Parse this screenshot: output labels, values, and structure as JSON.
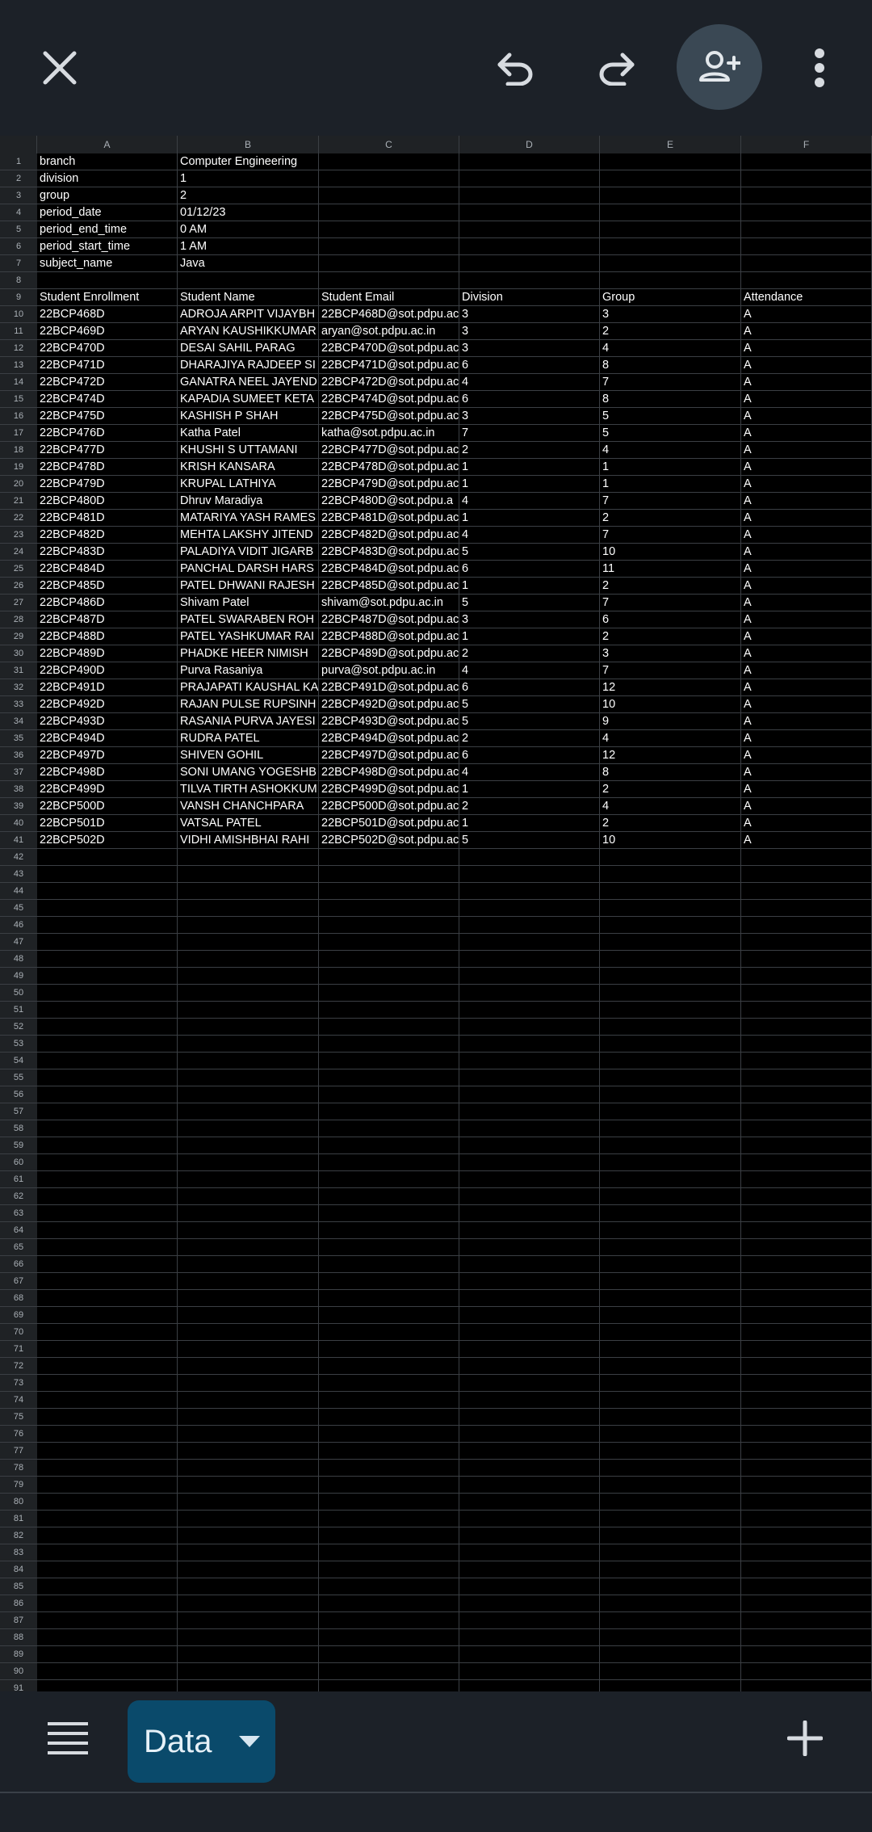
{
  "toolbar": {
    "close_icon": "close-icon",
    "undo_icon": "undo-icon",
    "redo_icon": "redo-icon",
    "share_icon": "add-person-icon",
    "more_icon": "more-vert-icon"
  },
  "columns": [
    "A",
    "B",
    "C",
    "D",
    "E",
    "F"
  ],
  "rows": [
    {
      "n": "1",
      "cells": [
        "branch",
        "Computer Engineering",
        "",
        "",
        "",
        ""
      ]
    },
    {
      "n": "2",
      "cells": [
        "division",
        "1",
        "",
        "",
        "",
        ""
      ]
    },
    {
      "n": "3",
      "cells": [
        "group",
        "2",
        "",
        "",
        "",
        ""
      ]
    },
    {
      "n": "4",
      "cells": [
        "period_date",
        "01/12/23",
        "",
        "",
        "",
        ""
      ]
    },
    {
      "n": "5",
      "cells": [
        "period_end_time",
        "0 AM",
        "",
        "",
        "",
        ""
      ]
    },
    {
      "n": "6",
      "cells": [
        "period_start_time",
        "1 AM",
        "",
        "",
        "",
        ""
      ]
    },
    {
      "n": "7",
      "cells": [
        "subject_name",
        "Java",
        "",
        "",
        "",
        ""
      ]
    },
    {
      "n": "8",
      "cells": [
        "",
        "",
        "",
        "",
        "",
        ""
      ]
    },
    {
      "n": "9",
      "cells": [
        "Student Enrollment",
        "Student Name",
        "Student Email",
        "Division",
        "Group",
        "Attendance"
      ]
    },
    {
      "n": "10",
      "cells": [
        "22BCP468D",
        "ADROJA ARPIT VIJAYBH",
        "22BCP468D@sot.pdpu.ac",
        "3",
        "3",
        "A"
      ]
    },
    {
      "n": "11",
      "cells": [
        "22BCP469D",
        "ARYAN KAUSHIKKUMAR",
        "aryan@sot.pdpu.ac.in",
        "3",
        "2",
        "A"
      ]
    },
    {
      "n": "12",
      "cells": [
        "22BCP470D",
        "DESAI SAHIL PARAG",
        "22BCP470D@sot.pdpu.ac",
        "3",
        "4",
        "A"
      ]
    },
    {
      "n": "13",
      "cells": [
        "22BCP471D",
        "DHARAJIYA RAJDEEP SI",
        "22BCP471D@sot.pdpu.ac",
        "6",
        "8",
        "A"
      ]
    },
    {
      "n": "14",
      "cells": [
        "22BCP472D",
        "GANATRA NEEL JAYEND",
        "22BCP472D@sot.pdpu.ac",
        "4",
        "7",
        "A"
      ]
    },
    {
      "n": "15",
      "cells": [
        "22BCP474D",
        "KAPADIA SUMEET KETA",
        "22BCP474D@sot.pdpu.ac",
        "6",
        "8",
        "A"
      ]
    },
    {
      "n": "16",
      "cells": [
        "22BCP475D",
        "KASHISH P SHAH",
        "22BCP475D@sot.pdpu.ac",
        "3",
        "5",
        "A"
      ]
    },
    {
      "n": "17",
      "cells": [
        "22BCP476D",
        "Katha Patel",
        "katha@sot.pdpu.ac.in",
        "7",
        "5",
        "A"
      ]
    },
    {
      "n": "18",
      "cells": [
        "22BCP477D",
        "KHUSHI S UTTAMANI",
        "22BCP477D@sot.pdpu.ac",
        "2",
        "4",
        "A"
      ]
    },
    {
      "n": "19",
      "cells": [
        "22BCP478D",
        "KRISH KANSARA",
        "22BCP478D@sot.pdpu.ac",
        "1",
        "1",
        "A"
      ]
    },
    {
      "n": "20",
      "cells": [
        "22BCP479D",
        "KRUPAL LATHIYA",
        "22BCP479D@sot.pdpu.ac",
        "1",
        "1",
        "A"
      ]
    },
    {
      "n": "21",
      "cells": [
        "22BCP480D",
        "Dhruv Maradiya",
        " 22BCP480D@sot.pdpu.a",
        "4",
        "7",
        "A"
      ]
    },
    {
      "n": "22",
      "cells": [
        "22BCP481D",
        "MATARIYA YASH RAMES",
        "22BCP481D@sot.pdpu.ac",
        "1",
        "2",
        "A"
      ]
    },
    {
      "n": "23",
      "cells": [
        "22BCP482D",
        "MEHTA LAKSHY JITEND",
        "22BCP482D@sot.pdpu.ac",
        "4",
        "7",
        "A"
      ]
    },
    {
      "n": "24",
      "cells": [
        "22BCP483D",
        "PALADIYA VIDIT JIGARB",
        "22BCP483D@sot.pdpu.ac",
        "5",
        "10",
        "A"
      ]
    },
    {
      "n": "25",
      "cells": [
        "22BCP484D",
        "PANCHAL DARSH HARS",
        "22BCP484D@sot.pdpu.ac",
        "6",
        "11",
        "A"
      ]
    },
    {
      "n": "26",
      "cells": [
        "22BCP485D",
        "PATEL DHWANI RAJESH",
        "22BCP485D@sot.pdpu.ac",
        "1",
        "2",
        "A"
      ]
    },
    {
      "n": "27",
      "cells": [
        "22BCP486D",
        "Shivam Patel",
        "shivam@sot.pdpu.ac.in",
        "5",
        "7",
        "A"
      ]
    },
    {
      "n": "28",
      "cells": [
        "22BCP487D",
        "PATEL SWARABEN ROH",
        "22BCP487D@sot.pdpu.ac",
        "3",
        "6",
        "A"
      ]
    },
    {
      "n": "29",
      "cells": [
        "22BCP488D",
        "PATEL YASHKUMAR RAI",
        "22BCP488D@sot.pdpu.ac",
        "1",
        "2",
        "A"
      ]
    },
    {
      "n": "30",
      "cells": [
        "22BCP489D",
        "PHADKE HEER NIMISH",
        "22BCP489D@sot.pdpu.ac",
        "2",
        "3",
        "A"
      ]
    },
    {
      "n": "31",
      "cells": [
        "22BCP490D",
        "Purva Rasaniya",
        "purva@sot.pdpu.ac.in",
        "4",
        "7",
        "A"
      ]
    },
    {
      "n": "32",
      "cells": [
        "22BCP491D",
        "PRAJAPATI KAUSHAL KA",
        "22BCP491D@sot.pdpu.ac",
        "6",
        "12",
        "A"
      ]
    },
    {
      "n": "33",
      "cells": [
        "22BCP492D",
        "RAJAN PULSE RUPSINH",
        "22BCP492D@sot.pdpu.ac",
        "5",
        "10",
        "A"
      ]
    },
    {
      "n": "34",
      "cells": [
        "22BCP493D",
        "RASANIA PURVA JAYESI",
        "22BCP493D@sot.pdpu.ac",
        "5",
        "9",
        "A"
      ]
    },
    {
      "n": "35",
      "cells": [
        "22BCP494D",
        "RUDRA PATEL",
        "22BCP494D@sot.pdpu.ac",
        "2",
        "4",
        "A"
      ]
    },
    {
      "n": "36",
      "cells": [
        "22BCP497D",
        "SHIVEN GOHIL",
        "22BCP497D@sot.pdpu.ac",
        "6",
        "12",
        "A"
      ]
    },
    {
      "n": "37",
      "cells": [
        "22BCP498D",
        "SONI UMANG YOGESHB",
        "22BCP498D@sot.pdpu.ac",
        "4",
        "8",
        "A"
      ]
    },
    {
      "n": "38",
      "cells": [
        "22BCP499D",
        "TILVA TIRTH ASHOKKUM",
        "22BCP499D@sot.pdpu.ac",
        "1",
        "2",
        "A"
      ]
    },
    {
      "n": "39",
      "cells": [
        "22BCP500D",
        "VANSH CHANCHPARA",
        "22BCP500D@sot.pdpu.ac",
        "2",
        "4",
        "A"
      ]
    },
    {
      "n": "40",
      "cells": [
        "22BCP501D",
        "VATSAL PATEL",
        "22BCP501D@sot.pdpu.ac",
        "1",
        "2",
        "A"
      ]
    },
    {
      "n": "41",
      "cells": [
        "22BCP502D",
        "VIDHI AMISHBHAI RAHI",
        "22BCP502D@sot.pdpu.ac",
        "5",
        "10",
        "A"
      ]
    }
  ],
  "empty_row_numbers": [
    "42",
    "43",
    "44",
    "45",
    "46",
    "47",
    "48",
    "49",
    "50",
    "51",
    "52",
    "53",
    "54",
    "55",
    "56",
    "57",
    "58",
    "59",
    "60",
    "61",
    "62",
    "63",
    "64",
    "65",
    "66",
    "67",
    "68",
    "69",
    "70",
    "71",
    "72",
    "73",
    "74",
    "75",
    "76",
    "77",
    "78",
    "79",
    "80",
    "81",
    "82",
    "83",
    "84",
    "85",
    "86",
    "87",
    "88",
    "89",
    "90",
    "91"
  ],
  "bottom": {
    "menu_icon": "sheets-list-icon",
    "sheet_tab_label": "Data",
    "sheet_tab_icon": "caret-down-icon",
    "add_sheet_icon": "plus-icon"
  },
  "colors": {
    "toolbar_bg": "#1c2128",
    "grid_bg": "#000000",
    "header_bg": "#1f2225",
    "gridline": "#3b3f44",
    "sheet_tab_bg": "#0a4a6b",
    "share_button_bg": "#3a4854"
  }
}
